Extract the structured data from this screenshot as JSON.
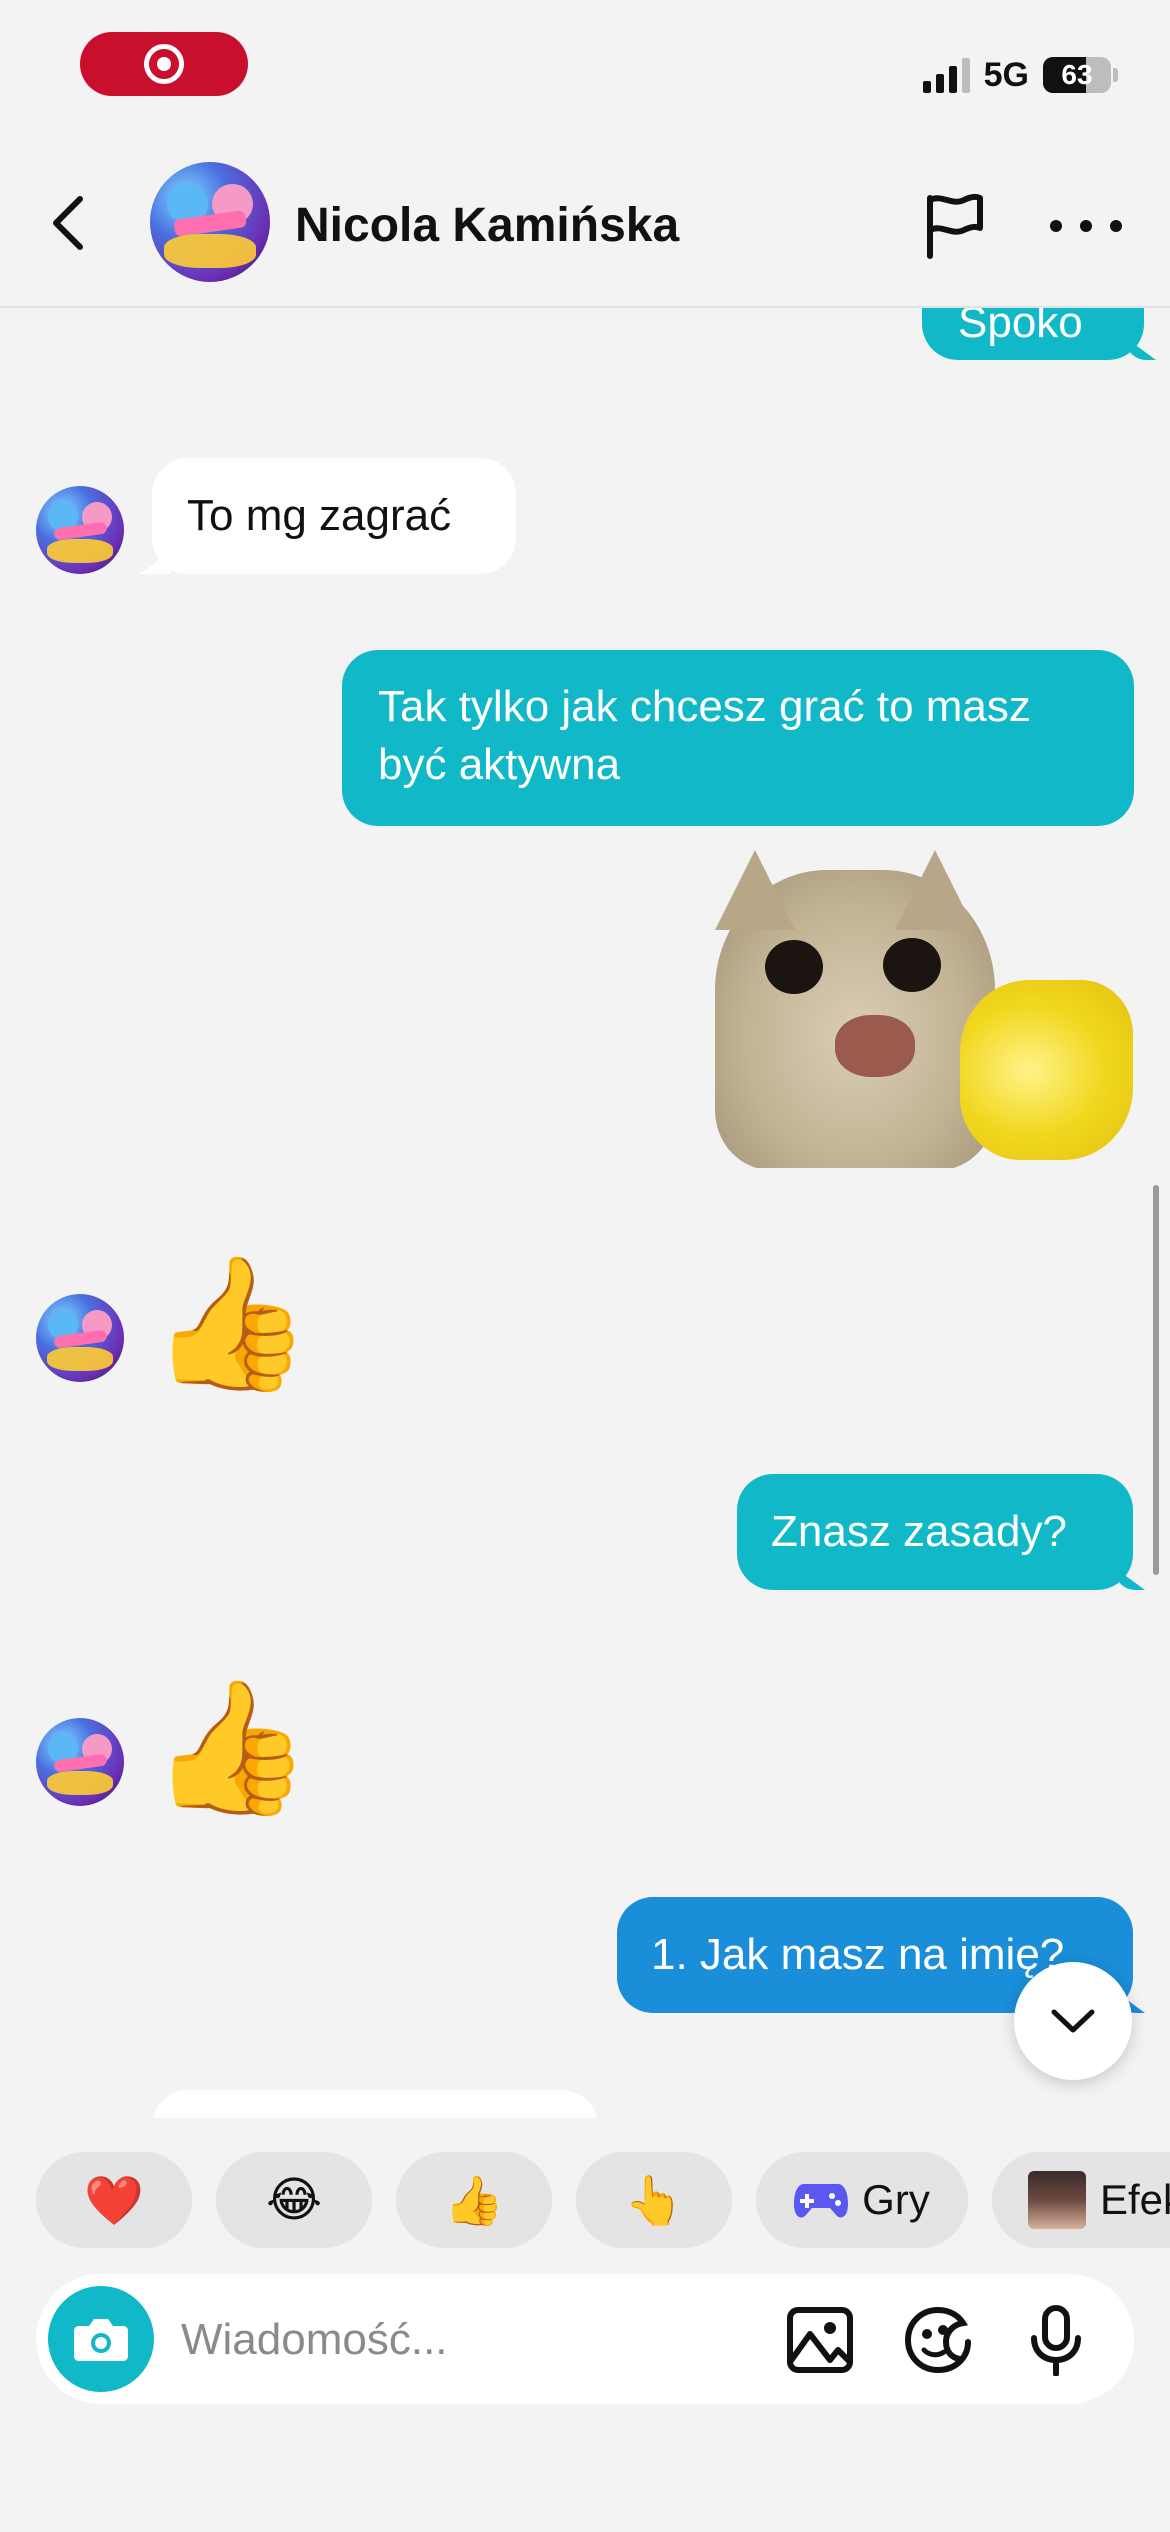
{
  "status": {
    "network": "5G",
    "battery": "63"
  },
  "header": {
    "name": "Nicola Kamińska"
  },
  "messages": [
    {
      "text": "Spoko"
    },
    {
      "text": "To mg zagrać"
    },
    {
      "text": "Tak tylko jak chcesz grać to masz być aktywna"
    },
    {
      "text": "👍"
    },
    {
      "text": "Znasz zasady?"
    },
    {
      "text": "👍"
    },
    {
      "text": "1. Jak masz na imię?"
    }
  ],
  "quick_replies": [
    {
      "emoji": "❤️"
    },
    {
      "emoji": "😂"
    },
    {
      "emoji": "👍"
    },
    {
      "emoji": "👆"
    },
    {
      "label": "Gry"
    },
    {
      "label": "Efekt"
    }
  ],
  "composer": {
    "placeholder": "Wiadomość..."
  }
}
